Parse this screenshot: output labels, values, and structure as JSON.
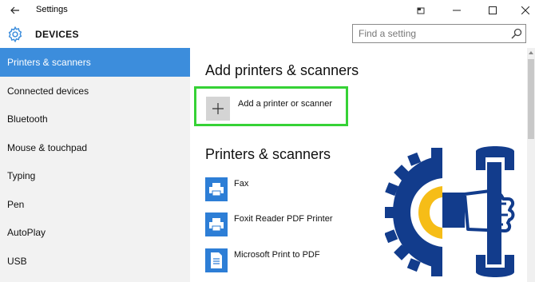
{
  "window": {
    "title": "Settings",
    "controls": [
      "minimize",
      "maximize",
      "close"
    ]
  },
  "header": {
    "section": "DEVICES",
    "icon": "gear-icon"
  },
  "search": {
    "placeholder": "Find a setting"
  },
  "sidebar": {
    "items": [
      {
        "label": "Printers & scanners",
        "active": true
      },
      {
        "label": "Connected devices",
        "active": false
      },
      {
        "label": "Bluetooth",
        "active": false
      },
      {
        "label": "Mouse & touchpad",
        "active": false
      },
      {
        "label": "Typing",
        "active": false
      },
      {
        "label": "Pen",
        "active": false
      },
      {
        "label": "AutoPlay",
        "active": false
      },
      {
        "label": "USB",
        "active": false
      }
    ]
  },
  "main": {
    "add_heading": "Add printers & scanners",
    "add_button_label": "Add a printer or scanner",
    "printers_heading": "Printers & scanners",
    "printers": [
      {
        "name": "Fax",
        "icon": "printer-icon"
      },
      {
        "name": "Foxit Reader PDF Printer",
        "icon": "printer-icon"
      },
      {
        "name": "Microsoft Print to PDF",
        "icon": "pdf-printer-icon"
      }
    ]
  },
  "colors": {
    "accent": "#3c8ddc",
    "highlight_border": "#36d236",
    "logo_blue": "#123c8c",
    "logo_yellow": "#f6bd17"
  }
}
